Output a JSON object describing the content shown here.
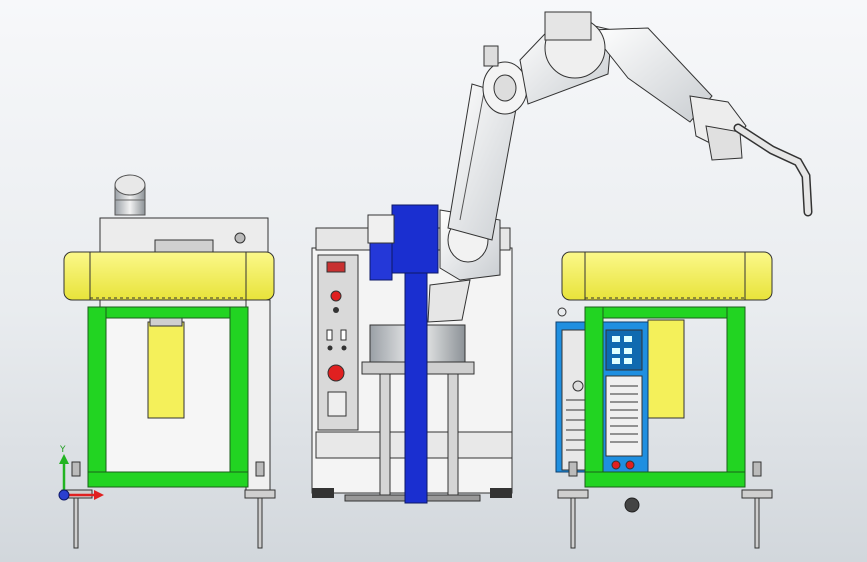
{
  "scene": {
    "kind": "cad-assembly-front-view",
    "components": [
      "left-equipment-frame",
      "robot-control-cabinet",
      "six-axis-welding-robot",
      "right-welding-station-frame",
      "welding-power-supply"
    ]
  },
  "colors": {
    "background_top": "#f7f8fa",
    "background_bottom": "#d2d7dc",
    "frame_green": "#22d422",
    "cover_yellow": "#f4f05a",
    "robot_base_blue": "#1a2fd0",
    "cabinet_grey": "#d9d9d9",
    "estop_red": "#e02020",
    "power_supply_blue": "#1f8fe0"
  },
  "triad": {
    "y_label": "Y",
    "icons": [
      "y-axis-arrow-icon",
      "x-axis-arrow-icon",
      "origin-sphere-icon"
    ]
  }
}
